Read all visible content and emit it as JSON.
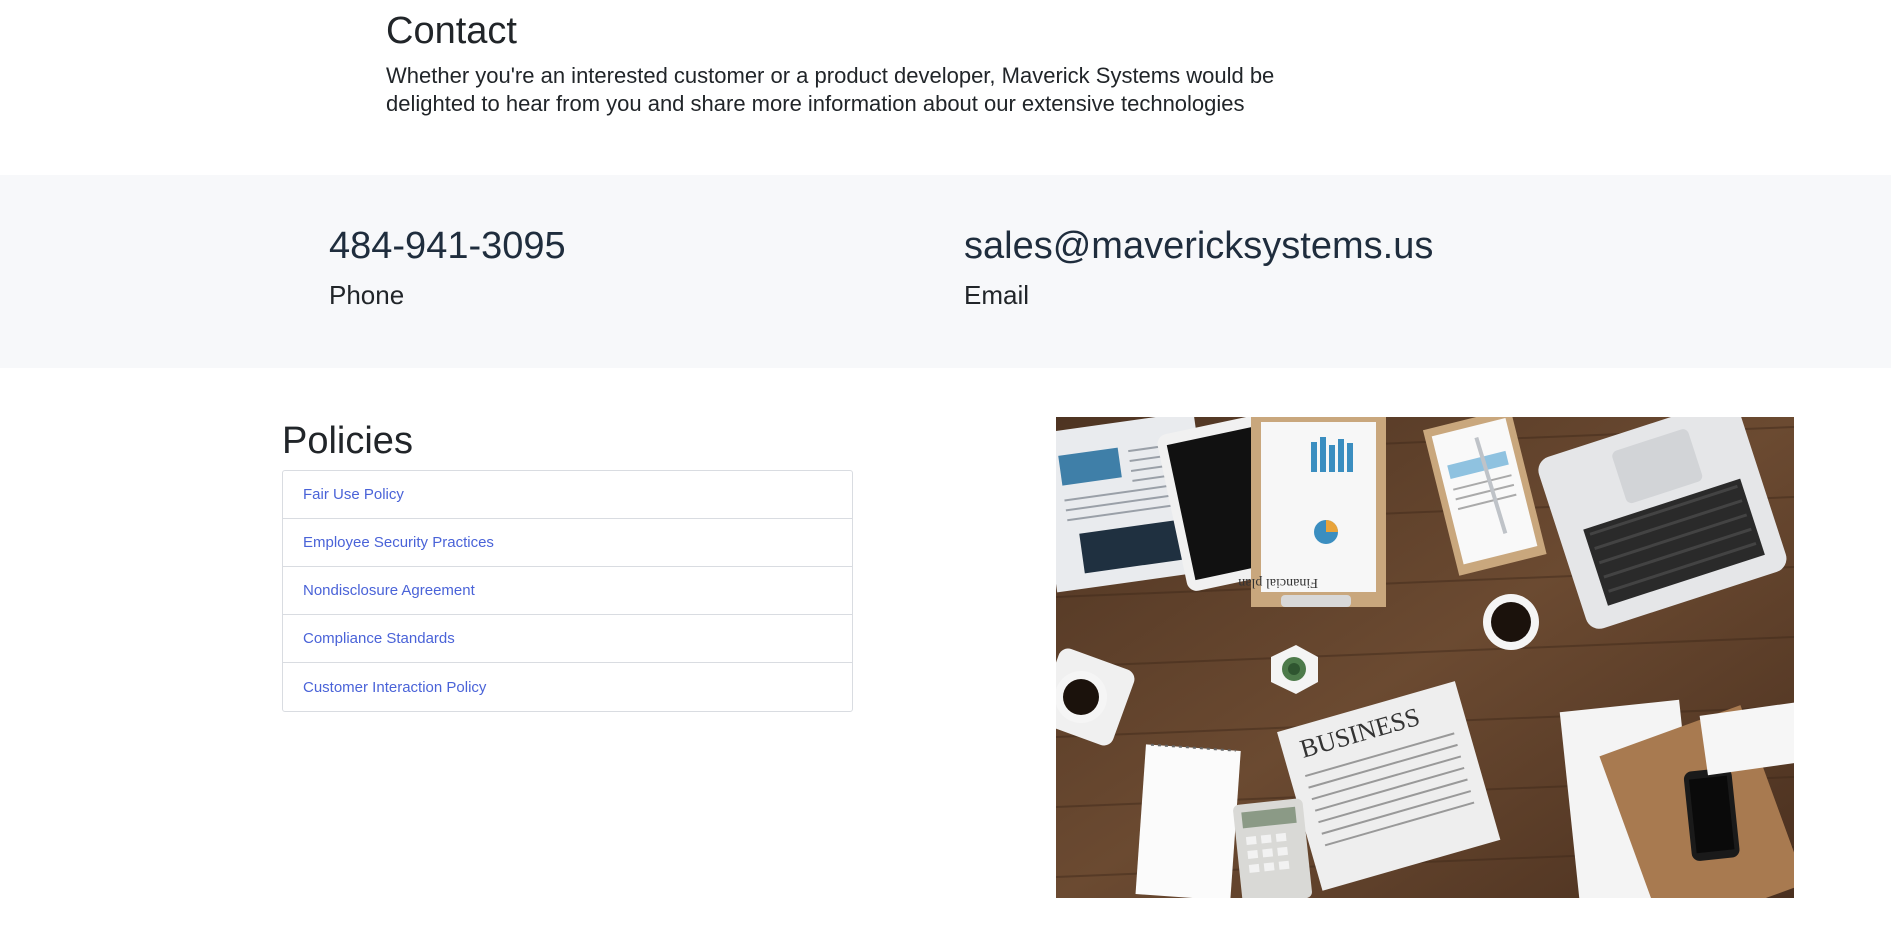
{
  "contact": {
    "title": "Contact",
    "description": "Whether you're an interested customer or a product developer, Maverick Systems would be delighted to hear from you and share more information about our extensive technologies"
  },
  "phone": {
    "value": "484-941-3095",
    "label": "Phone"
  },
  "email": {
    "value": "sales@mavericksystems.us",
    "label": "Email"
  },
  "policies": {
    "title": "Policies",
    "items": [
      "Fair Use Policy",
      "Employee Security Practices",
      "Nondisclosure Agreement",
      "Compliance Standards",
      "Customer Interaction Policy"
    ]
  },
  "image": {
    "newspaper_headline": "BUSINESS",
    "clipboard_text": "Financial plan"
  }
}
